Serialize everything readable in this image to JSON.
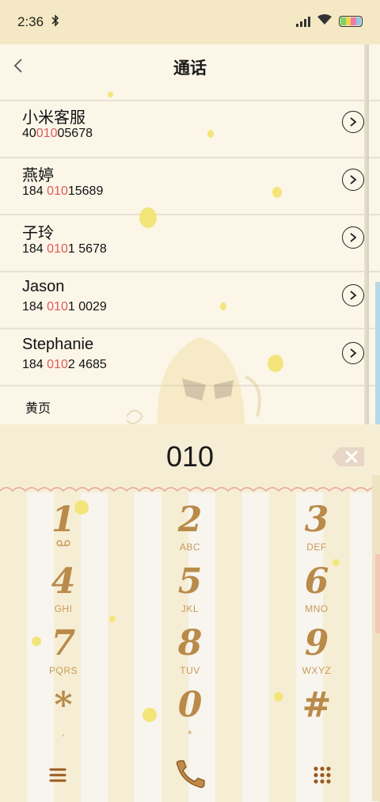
{
  "status_bar": {
    "time": "2:36"
  },
  "header": {
    "title": "通话"
  },
  "contacts": [
    {
      "name": "小米客服",
      "number_pre": "40",
      "number_match": "010",
      "number_post": "05678"
    },
    {
      "name": "燕婷",
      "number_pre": "184 ",
      "number_match": "010",
      "number_post": "15689"
    },
    {
      "name": "子玲",
      "number_pre": "184 ",
      "number_match": "010",
      "number_post": "1 5678"
    },
    {
      "name": "Jason",
      "number_pre": "184 ",
      "number_match": "010",
      "number_post": "1 0029"
    },
    {
      "name": "Stephanie",
      "number_pre": "184 ",
      "number_match": "010",
      "number_post": "2 4685"
    }
  ],
  "yellow_pages_label": "黄页",
  "dialer": {
    "digits": "010",
    "keys": [
      {
        "digit": "1",
        "letters": ""
      },
      {
        "digit": "2",
        "letters": "ABC"
      },
      {
        "digit": "3",
        "letters": "DEF"
      },
      {
        "digit": "4",
        "letters": "GHI"
      },
      {
        "digit": "5",
        "letters": "JKL"
      },
      {
        "digit": "6",
        "letters": "MNO"
      },
      {
        "digit": "7",
        "letters": "PQRS"
      },
      {
        "digit": "8",
        "letters": "TUV"
      },
      {
        "digit": "9",
        "letters": "WXYZ"
      },
      {
        "digit": "*",
        "letters": ","
      },
      {
        "digit": "0",
        "letters": "+"
      },
      {
        "digit": "#",
        "letters": ""
      }
    ]
  },
  "icons": {
    "back": "back-icon",
    "detail": "chevron-right-circle-icon",
    "backspace": "backspace-icon",
    "voicemail": "voicemail-icon",
    "menu": "menu-icon",
    "call": "phone-icon",
    "keypad": "keypad-icon"
  },
  "colors": {
    "match_highlight": "#e05a5a",
    "key_brown": "#b98a4a",
    "status_bar_bg": "#f5e8c4"
  }
}
